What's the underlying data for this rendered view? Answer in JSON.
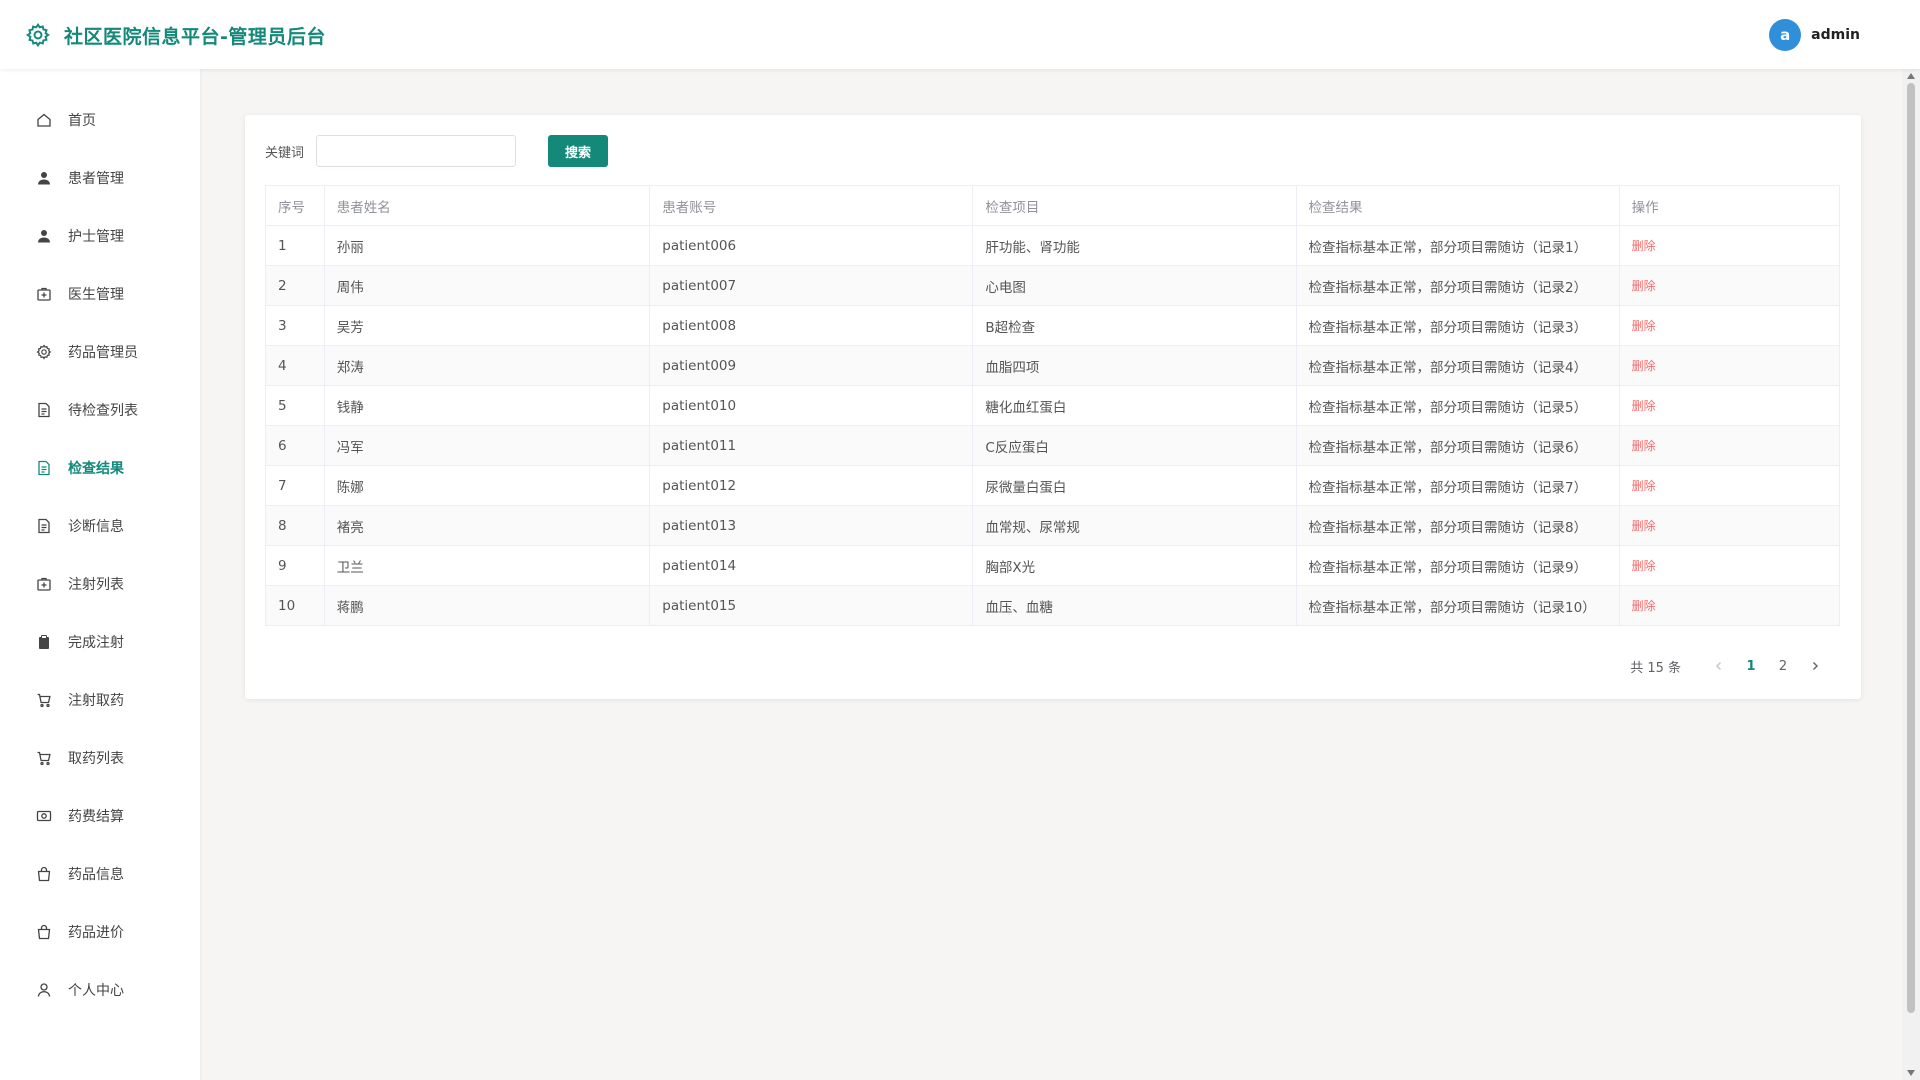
{
  "header": {
    "title": "社区医院信息平台-管理员后台",
    "avatar_letter": "a",
    "username": "admin"
  },
  "sidebar": {
    "items": [
      {
        "label": "首页",
        "icon": "home-icon"
      },
      {
        "label": "患者管理",
        "icon": "user-icon"
      },
      {
        "label": "护士管理",
        "icon": "user-icon"
      },
      {
        "label": "医生管理",
        "icon": "medical-kit-icon"
      },
      {
        "label": "药品管理员",
        "icon": "gear-icon"
      },
      {
        "label": "待检查列表",
        "icon": "document-icon"
      },
      {
        "label": "检查结果",
        "icon": "document-icon",
        "active": true
      },
      {
        "label": "诊断信息",
        "icon": "document-icon"
      },
      {
        "label": "注射列表",
        "icon": "medical-kit-icon"
      },
      {
        "label": "完成注射",
        "icon": "clipboard-icon"
      },
      {
        "label": "注射取药",
        "icon": "cart-icon"
      },
      {
        "label": "取药列表",
        "icon": "cart-icon"
      },
      {
        "label": "药费结算",
        "icon": "money-icon"
      },
      {
        "label": "药品信息",
        "icon": "bag-icon"
      },
      {
        "label": "药品进价",
        "icon": "bag-icon"
      },
      {
        "label": "个人中心",
        "icon": "user-outline-icon"
      }
    ]
  },
  "search": {
    "label": "关键词",
    "value": "",
    "placeholder": "",
    "button_label": "搜索"
  },
  "table": {
    "headers": [
      "序号",
      "患者姓名",
      "患者账号",
      "检查项目",
      "检查结果",
      "操作"
    ],
    "delete_label": "删除",
    "rows": [
      {
        "no": "1",
        "name": "孙丽",
        "account": "patient006",
        "item": "肝功能、肾功能",
        "result": "检查指标基本正常，部分项目需随访（记录1）"
      },
      {
        "no": "2",
        "name": "周伟",
        "account": "patient007",
        "item": "心电图",
        "result": "检查指标基本正常，部分项目需随访（记录2）"
      },
      {
        "no": "3",
        "name": "吴芳",
        "account": "patient008",
        "item": "B超检查",
        "result": "检查指标基本正常，部分项目需随访（记录3）"
      },
      {
        "no": "4",
        "name": "郑涛",
        "account": "patient009",
        "item": "血脂四项",
        "result": "检查指标基本正常，部分项目需随访（记录4）"
      },
      {
        "no": "5",
        "name": "钱静",
        "account": "patient010",
        "item": "糖化血红蛋白",
        "result": "检查指标基本正常，部分项目需随访（记录5）"
      },
      {
        "no": "6",
        "name": "冯军",
        "account": "patient011",
        "item": "C反应蛋白",
        "result": "检查指标基本正常，部分项目需随访（记录6）"
      },
      {
        "no": "7",
        "name": "陈娜",
        "account": "patient012",
        "item": "尿微量白蛋白",
        "result": "检查指标基本正常，部分项目需随访（记录7）"
      },
      {
        "no": "8",
        "name": "褚亮",
        "account": "patient013",
        "item": "血常规、尿常规",
        "result": "检查指标基本正常，部分项目需随访（记录8）"
      },
      {
        "no": "9",
        "name": "卫兰",
        "account": "patient014",
        "item": "胸部X光",
        "result": "检查指标基本正常，部分项目需随访（记录9）"
      },
      {
        "no": "10",
        "name": "蒋鹏",
        "account": "patient015",
        "item": "血压、血糖",
        "result": "检查指标基本正常，部分项目需随访（记录10）"
      }
    ]
  },
  "pagination": {
    "total_text": "共 15 条",
    "pages": [
      "1",
      "2"
    ],
    "current": "1",
    "prev_icon": "chevron-left-icon",
    "next_icon": "chevron-right-icon"
  },
  "colors": {
    "brand": "#14897a",
    "avatar": "#2f8fd8",
    "danger": "#f56c6c"
  }
}
